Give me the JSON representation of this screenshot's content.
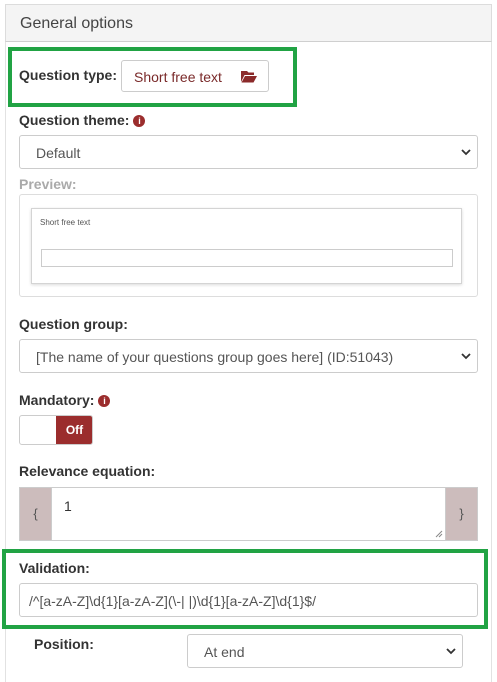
{
  "panel": {
    "title": "General options"
  },
  "question_type": {
    "label": "Question type:",
    "value": "Short free text",
    "icon": "folder-open-icon"
  },
  "question_theme": {
    "label": "Question theme:",
    "value": "Default",
    "info_icon": "info-circle-icon"
  },
  "preview": {
    "label": "Preview:",
    "question_text": "Short free text"
  },
  "question_group": {
    "label": "Question group:",
    "value": "[The name of your questions group goes here] (ID:51043)"
  },
  "mandatory": {
    "label": "Mandatory:",
    "toggle_label": "Off",
    "state": "off",
    "info_icon": "info-circle-icon"
  },
  "relevance": {
    "label": "Relevance equation:",
    "open_brace": "{",
    "close_brace": "}",
    "value": "1"
  },
  "validation": {
    "label": "Validation:",
    "value": "/^[a-zA-Z]\\d{1}[a-zA-Z](\\-| |)\\d{1}[a-zA-Z]\\d{1}$/"
  },
  "position": {
    "label": "Position:",
    "value": "At end"
  },
  "colors": {
    "highlight": "#21a344",
    "accent": "#9b2d2d",
    "brace_bg": "#ccbcbc"
  }
}
